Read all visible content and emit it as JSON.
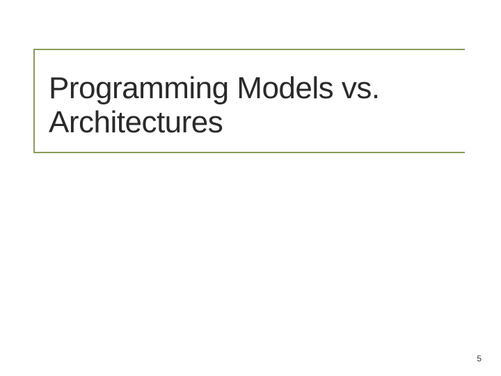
{
  "slide": {
    "title": "Programming Models vs. Architectures",
    "page_number": "5"
  }
}
